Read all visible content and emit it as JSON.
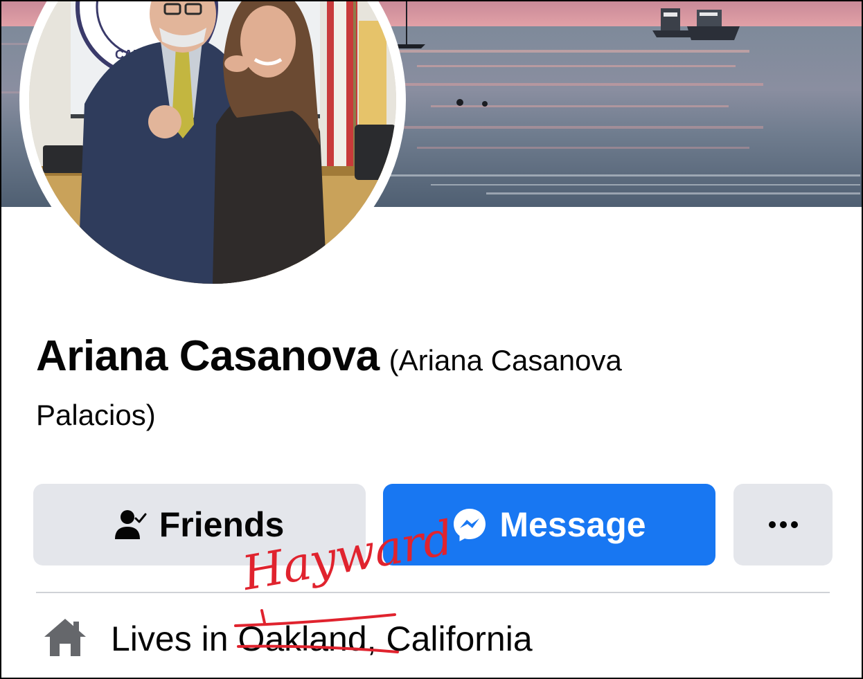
{
  "profile": {
    "name": "Ariana Casanova",
    "alternate_name_part1": "(Ariana Casanova",
    "alternate_name_part2": "Palacios)"
  },
  "actions": {
    "friends_label": "Friends",
    "message_label": "Message",
    "more_label": "•••"
  },
  "intro": {
    "lives_prefix": "Lives in ",
    "city_struck": "Oakland,",
    "state": " California",
    "handwritten_correction": "Hayward"
  },
  "avatar_photo": {
    "seal_text": "CALIFORN"
  },
  "colors": {
    "primary_blue": "#1877f2",
    "button_gray": "#e4e6eb",
    "annotation_red": "#e0232e"
  },
  "icons": {
    "friends": "person-check-icon",
    "message": "messenger-icon",
    "more": "more-dots-icon",
    "home": "home-icon"
  }
}
